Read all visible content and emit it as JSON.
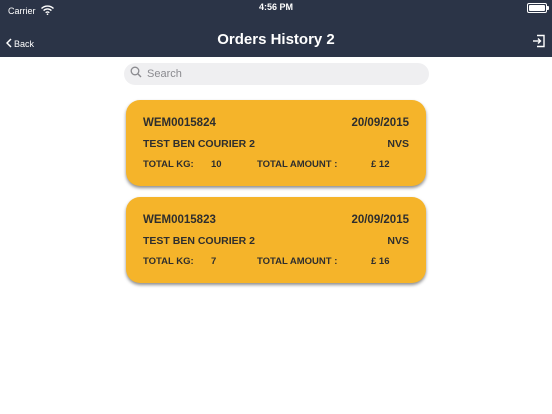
{
  "status_bar": {
    "carrier": "Carrier",
    "time": "4:56 PM"
  },
  "nav": {
    "back_label": "Back",
    "title": "Orders History 2"
  },
  "search": {
    "placeholder": "Search"
  },
  "labels": {
    "total_kg": "TOTAL KG:",
    "total_amount": "TOTAL AMOUNT :"
  },
  "orders": [
    {
      "id": "WEM0015824",
      "date": "20/09/2015",
      "courier": "TEST BEN COURIER 2",
      "code": "NVS",
      "total_kg": "10",
      "total_amount": "£ 12"
    },
    {
      "id": "WEM0015823",
      "date": "20/09/2015",
      "courier": "TEST BEN COURIER 2",
      "code": "NVS",
      "total_kg": "7",
      "total_amount": "£ 16"
    }
  ],
  "colors": {
    "nav_background": "#2b3447",
    "card_background": "#f5b42a"
  },
  "icons": [
    "wifi-icon",
    "battery-icon",
    "chevron-left-icon",
    "logout-icon",
    "search-icon"
  ]
}
